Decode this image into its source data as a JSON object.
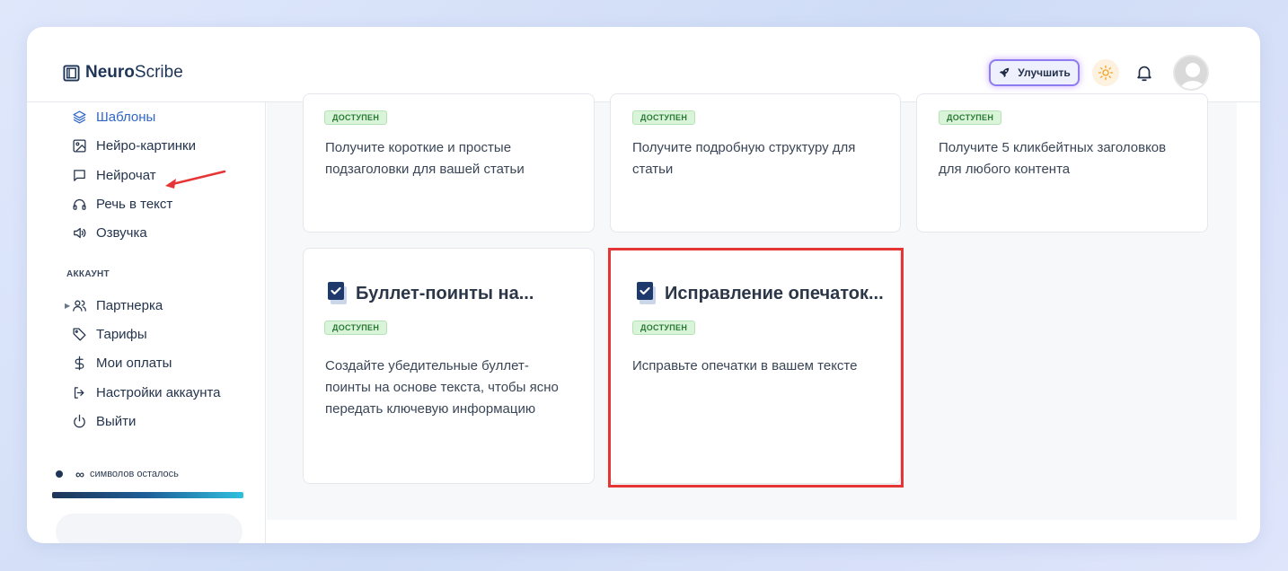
{
  "app": {
    "logo_bold": "Neuro",
    "logo_rest": "Scribe"
  },
  "header": {
    "upgrade_label": "Улучшить"
  },
  "sidebar": {
    "items": [
      {
        "label": "Шаблоны",
        "icon": "layers-icon",
        "active": true
      },
      {
        "label": "Нейро-картинки",
        "icon": "image-icon"
      },
      {
        "label": "Нейрочат",
        "icon": "chat-icon"
      },
      {
        "label": "Речь в текст",
        "icon": "headphones-icon"
      },
      {
        "label": "Озвучка",
        "icon": "speaker-icon"
      }
    ],
    "account_label": "АККАУНТ",
    "account_items": [
      {
        "label": "Партнерка",
        "icon": "users-icon"
      },
      {
        "label": "Тарифы",
        "icon": "tag-icon"
      },
      {
        "label": "Мои оплаты",
        "icon": "dollar-icon"
      },
      {
        "label": "Настройки аккаунта",
        "icon": "logout-arrow-icon"
      },
      {
        "label": "Выйти",
        "icon": "power-icon"
      }
    ],
    "quota_symbol": "∞",
    "quota_text": "символов осталось"
  },
  "cards": [
    {
      "badge": "ДОСТУПЕН",
      "desc": "Получите короткие и простые подзаголовки для вашей статьи"
    },
    {
      "badge": "ДОСТУПЕН",
      "desc": "Получите подробную структуру для статьи"
    },
    {
      "badge": "ДОСТУПЕН",
      "desc": "Получите 5 кликбейтных заголовков для любого контента"
    },
    {
      "title": "Буллет-поинты на...",
      "badge": "ДОСТУПЕН",
      "desc": "Создайте убедительные буллет-поинты на основе текста, чтобы ясно передать ключевую информацию"
    },
    {
      "title": "Исправление опечаток...",
      "badge": "ДОСТУПЕН",
      "desc": "Исправьте опечатки в вашем тексте"
    }
  ],
  "colors": {
    "accent": "#2f66c8",
    "brand_dark": "#1e3557",
    "badge_green": "#2a7a36",
    "highlight_red": "#e53535"
  }
}
